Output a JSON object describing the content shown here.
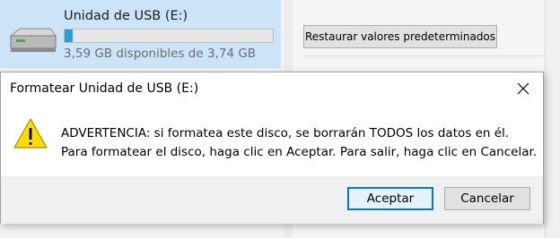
{
  "drive": {
    "name": "Unidad de USB (E:)",
    "free_text": "3,59 GB disponibles de 3,74 GB",
    "used_fraction": 0.04,
    "icon": "usb-drive-icon"
  },
  "properties": {
    "restore_label": "Restaurar valores predeterminados"
  },
  "dialog": {
    "title": "Formatear Unidad de USB (E:)",
    "icon": "warning-icon",
    "message_lines": [
      "ADVERTENCIA: si formatea este disco, se borrarán TODOS los datos en él.",
      "Para formatear el disco, haga clic en Aceptar. Para salir, haga clic en Cancelar."
    ],
    "ok_label": "Aceptar",
    "cancel_label": "Cancelar"
  },
  "colors": {
    "selection": "#cce4f7",
    "progress": "#26a0da",
    "focus_border": "#0078d7",
    "warning": "#ffdd00"
  }
}
